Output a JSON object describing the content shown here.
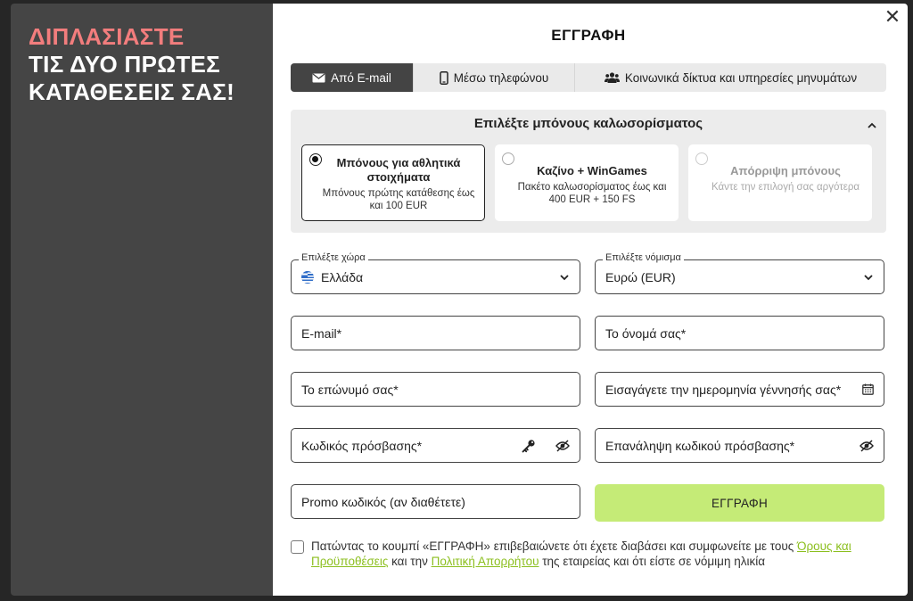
{
  "promo": {
    "line1": "ΔΙΠΛΑΣΙΑΣΤΕ",
    "line2": "ΤΙΣ ΔΥΟ ΠΡΩΤΕΣ",
    "line3": "ΚΑΤΑΘΕΣΕΙΣ ΣΑΣ!"
  },
  "dialog": {
    "title": "ΕΓΓΡΑΦΗ",
    "close": "✕"
  },
  "tabs": [
    {
      "label": "Από E-mail",
      "icon": "envelope-icon",
      "active": true
    },
    {
      "label": "Μέσω τηλεφώνου",
      "icon": "phone-icon",
      "active": false
    },
    {
      "label": "Κοινωνικά δίκτυα και υπηρεσίες μηνυμάτων",
      "icon": "users-icon",
      "active": false
    }
  ],
  "bonus": {
    "heading": "Επιλέξτε μπόνους καλωσορίσματος",
    "cards": [
      {
        "title": "Μπόνους για αθλητικά στοιχήματα",
        "desc": "Μπόνους πρώτης κατάθεσης έως και 100 EUR",
        "selected": true
      },
      {
        "title": "Καζίνο + WinGames",
        "desc": "Πακέτο καλωσορίσματος έως και 400 EUR + 150 FS",
        "selected": false
      },
      {
        "title": "Απόρριψη μπόνους",
        "desc": "Κάντε την επιλογή σας αργότερα",
        "selected": false
      }
    ]
  },
  "form": {
    "country": {
      "label": "Επιλέξτε χώρα",
      "value": "Ελλάδα"
    },
    "currency": {
      "label": "Επιλέξτε νόμισμα",
      "value": "Ευρώ (EUR)"
    },
    "email": {
      "placeholder": "E-mail*"
    },
    "first_name": {
      "placeholder": "Το όνομά σας*"
    },
    "last_name": {
      "placeholder": "Το επώνυμό σας*"
    },
    "birthdate": {
      "placeholder": "Εισαγάγετε την ημερομηνία γέννησής σας*"
    },
    "password": {
      "placeholder": "Κωδικός πρόσβασης*"
    },
    "password_repeat": {
      "placeholder": "Επανάληψη κωδικού πρόσβασης*"
    },
    "promo_code": {
      "placeholder": "Promo κωδικός (αν διαθέτετε)"
    },
    "submit": "ΕΓΓΡΑΦΗ"
  },
  "terms": {
    "text1": "Πατώντας το κουμπί «ΕΓΓΡΑΦΗ» επιβεβαιώνετε ότι έχετε διαβάσει και συμφωνείτε με τους ",
    "link1": "Όρους και Προϋποθέσεις",
    "text2": " και την ",
    "link2": "Πολιτική Απορρήτου",
    "text3": " της εταιρείας και ότι είστε σε νόμιμη ηλικία"
  },
  "colors": {
    "accent": "#c5eb77",
    "link": "#8cbf1f",
    "promo_highlight": "#f27d7d",
    "active_tab": "#444444"
  }
}
